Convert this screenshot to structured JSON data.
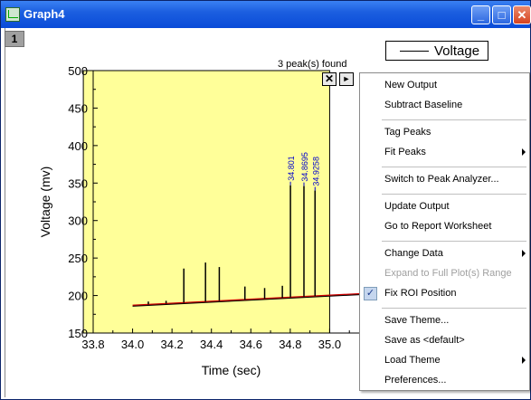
{
  "window": {
    "title": "Graph4",
    "buttons": {
      "minimize": "_",
      "maximize": "□",
      "close": "✕"
    },
    "colors": {
      "titlebar": "#0a4bd8",
      "roi_fill": "#ffff99",
      "roi_border": "#000000",
      "baseline": "#cc0000",
      "highlight_ellipse": "#e03ae0"
    }
  },
  "layer_tab": "1",
  "legend": {
    "label": "Voltage"
  },
  "roi": {
    "status": "3 peak(s) found",
    "close_icon": "✕",
    "next_icon": "►",
    "x_range": [
      33.75,
      35.0
    ]
  },
  "chart_data": {
    "type": "line",
    "xlabel": "Time (sec)",
    "ylabel": "Voltage (mv)",
    "xlim": [
      33.8,
      35.2
    ],
    "ylim": [
      150,
      500
    ],
    "x_ticks": [
      "33.8",
      "34.0",
      "34.2",
      "34.4",
      "34.6",
      "34.8",
      "35.0"
    ],
    "y_ticks": [
      "150",
      "200",
      "250",
      "300",
      "350",
      "400",
      "450",
      "500"
    ],
    "baseline": [
      {
        "x": 34.0,
        "y": 187
      },
      {
        "x": 35.2,
        "y": 203
      }
    ],
    "spikes": [
      {
        "x": 34.08,
        "y": 192
      },
      {
        "x": 34.17,
        "y": 193
      },
      {
        "x": 34.26,
        "y": 236
      },
      {
        "x": 34.37,
        "y": 244
      },
      {
        "x": 34.44,
        "y": 238
      },
      {
        "x": 34.57,
        "y": 212
      },
      {
        "x": 34.67,
        "y": 210
      },
      {
        "x": 34.76,
        "y": 213
      },
      {
        "x": 34.801,
        "y": 347
      },
      {
        "x": 34.8695,
        "y": 346
      },
      {
        "x": 34.9258,
        "y": 340
      }
    ],
    "peak_labels": [
      "34.801",
      "34.8695",
      "34.9258"
    ]
  },
  "context_menu": {
    "items": [
      {
        "label": "New Output",
        "enabled": true
      },
      {
        "label": "Subtract Baseline",
        "enabled": true
      },
      {
        "separator": true
      },
      {
        "label": "Tag Peaks",
        "enabled": true
      },
      {
        "label": "Fit Peaks",
        "enabled": true,
        "submenu": true
      },
      {
        "separator": true
      },
      {
        "label": "Switch to Peak Analyzer...",
        "enabled": true,
        "highlighted": true
      },
      {
        "separator": true
      },
      {
        "label": "Update Output",
        "enabled": true
      },
      {
        "label": "Go to Report Worksheet",
        "enabled": true
      },
      {
        "separator": true
      },
      {
        "label": "Change Data",
        "enabled": true,
        "submenu": true
      },
      {
        "label": "Expand to Full Plot(s) Range",
        "enabled": false
      },
      {
        "label": "Fix ROI Position",
        "enabled": true,
        "checked": true
      },
      {
        "separator": true
      },
      {
        "label": "Save Theme...",
        "enabled": true
      },
      {
        "label": "Save as <default>",
        "enabled": true
      },
      {
        "label": "Load Theme",
        "enabled": true,
        "submenu": true
      },
      {
        "label": "Preferences...",
        "enabled": true
      }
    ]
  }
}
